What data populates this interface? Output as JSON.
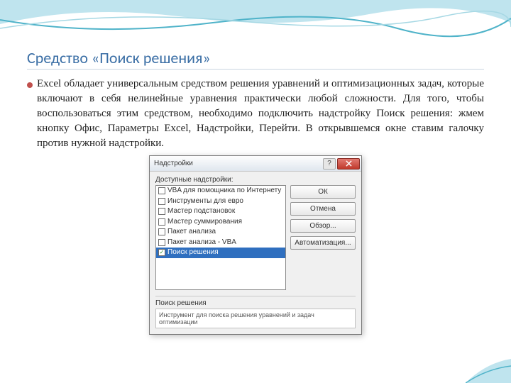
{
  "slide": {
    "title": "Средство «Поиск решения»",
    "paragraph": "Excel обладает универсальным средством решения уравнений и оптимизационных задач, которые включают в себя нелинейные уравнения практически любой сложности. Для того, чтобы воспользоваться этим средством, необходимо подключить надстройку Поиск решения: жмем кнопку Офис, Параметры Excel, Надстройки, Перейти. В открывшемся окне ставим галочку против нужной надстройки."
  },
  "dialog": {
    "title": "Надстройки",
    "available_label": "Доступные надстройки:",
    "items": [
      {
        "label": "VBA для помощника по Интернету",
        "checked": false
      },
      {
        "label": "Инструменты для евро",
        "checked": false
      },
      {
        "label": "Мастер подстановок",
        "checked": false
      },
      {
        "label": "Мастер суммирования",
        "checked": false
      },
      {
        "label": "Пакет анализа",
        "checked": false
      },
      {
        "label": "Пакет анализа - VBA",
        "checked": false
      },
      {
        "label": "Поиск решения",
        "checked": true,
        "selected": true
      }
    ],
    "buttons": {
      "ok": "ОК",
      "cancel": "Отмена",
      "browse": "Обзор...",
      "automation": "Автоматизация..."
    },
    "footer_label": "Поиск решения",
    "footer_desc": "Инструмент для поиска решения уравнений и задач оптимизации"
  }
}
